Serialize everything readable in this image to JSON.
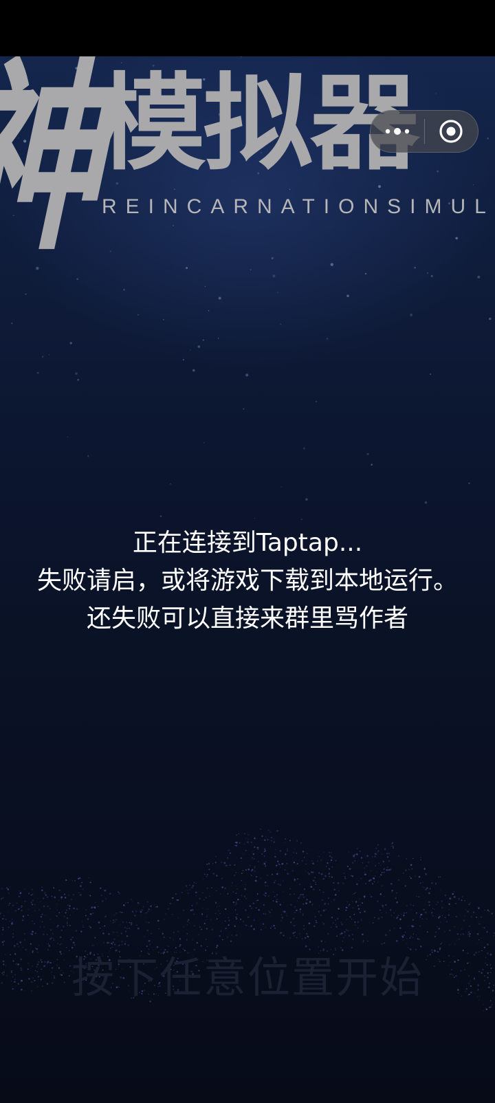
{
  "title": {
    "brush_char": "神",
    "main_chars": "模拟器",
    "latin": "REINCARNATIONSIMULATO"
  },
  "capsule": {
    "more_icon": "more-dots-icon",
    "close_icon": "close-target-icon"
  },
  "message": {
    "line1": "正在连接到Taptap...",
    "line2": "失败请启，或将游戏下载到本地运行。",
    "line3": "还失败可以直接来群里骂作者"
  },
  "start_prompt": "按下任意位置开始",
  "colors": {
    "background_top": "#14264d",
    "background_bottom": "#070b18",
    "title": "#a9a9ab",
    "message_text": "#ffffff",
    "prompt_text": "#1b2033"
  }
}
